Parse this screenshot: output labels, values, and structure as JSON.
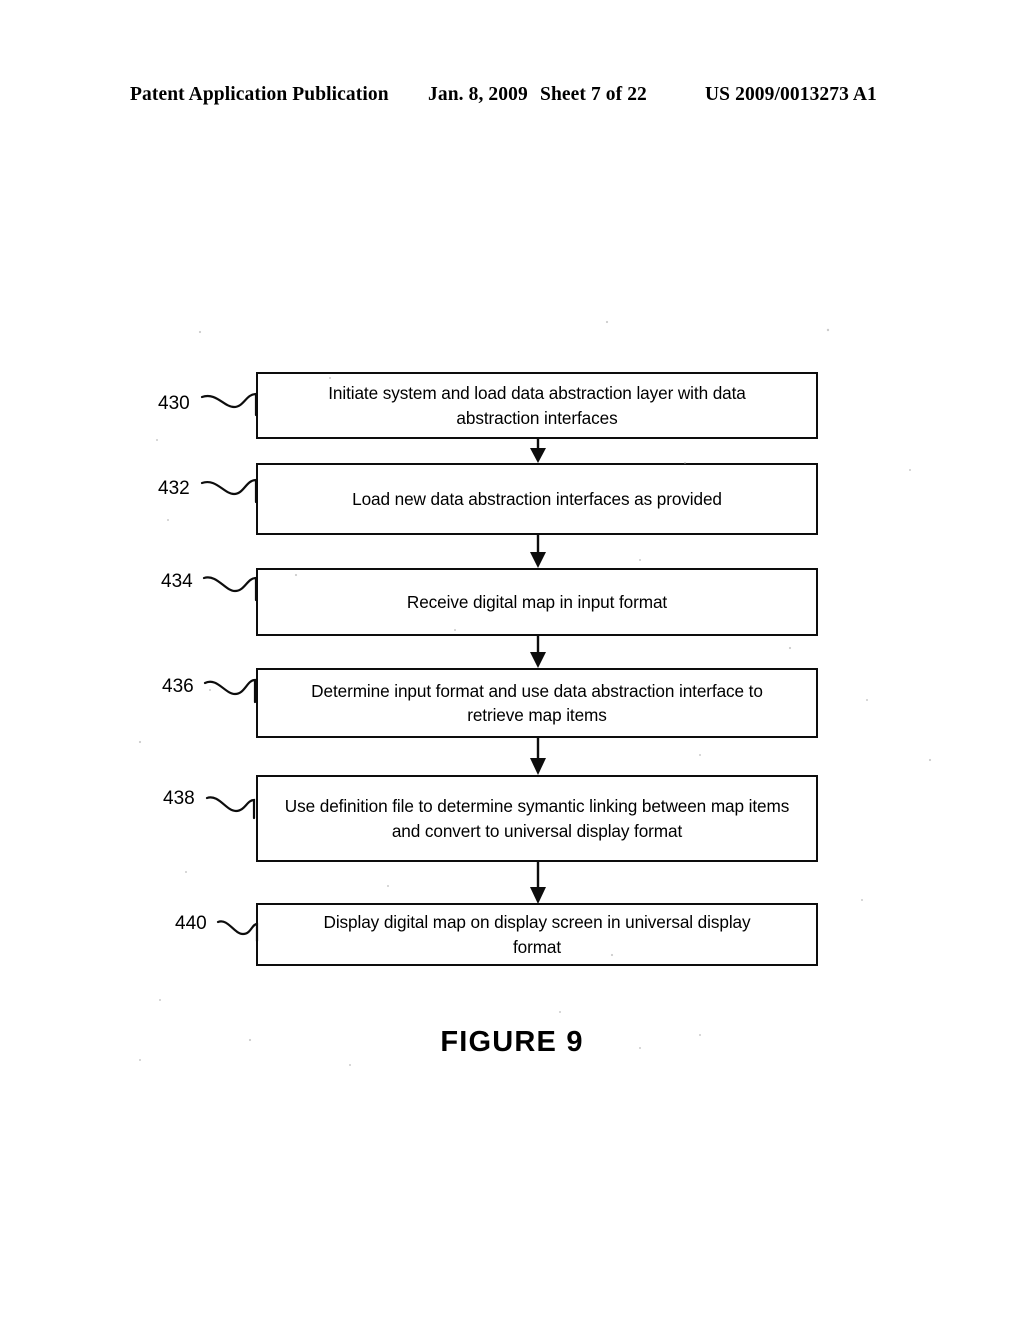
{
  "header": {
    "publication": "Patent Application Publication",
    "date": "Jan. 8, 2009",
    "sheet": "Sheet 7 of 22",
    "patent_number": "US 2009/0013273 A1"
  },
  "figure": {
    "caption": "FIGURE 9"
  },
  "flowchart": {
    "nodes": [
      {
        "ref": "430",
        "text": "Initiate system and load data abstraction layer with data\nabstraction interfaces"
      },
      {
        "ref": "432",
        "text": "Load new data abstraction interfaces as provided"
      },
      {
        "ref": "434",
        "text": "Receive digital map in input format"
      },
      {
        "ref": "436",
        "text": "Determine input format and use data abstraction interface to\nretrieve map items"
      },
      {
        "ref": "438",
        "text": "Use definition file to determine symantic linking between map items\nand convert to universal display format"
      },
      {
        "ref": "440",
        "text": "Display digital map on display screen in universal display\nformat"
      }
    ]
  },
  "colors": {
    "ink": "#0d0d0d",
    "paper": "#ffffff"
  }
}
